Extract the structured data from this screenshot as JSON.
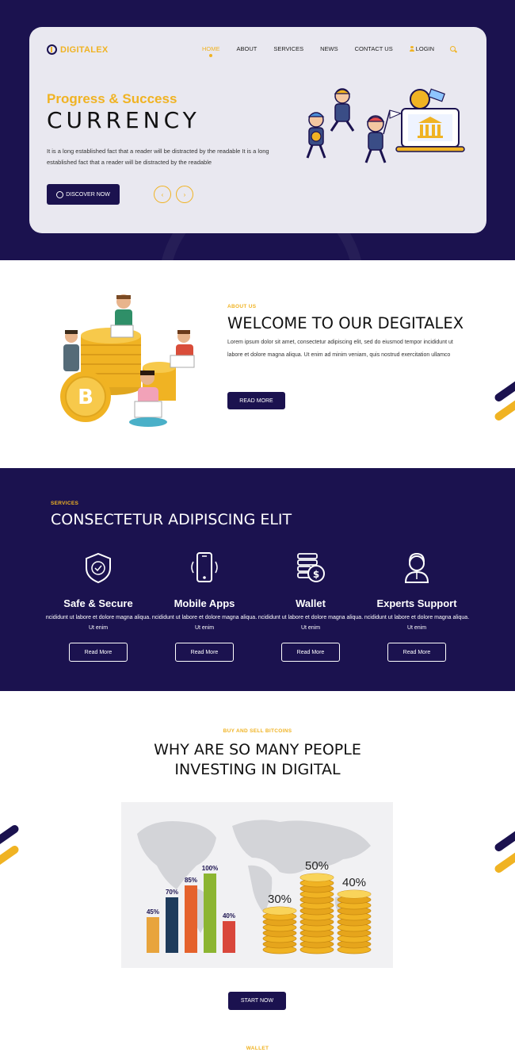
{
  "header": {
    "logo": "DIGITALEX",
    "nav": [
      "HOME",
      "ABOUT",
      "SERVICES",
      "NEWS",
      "CONTACT US"
    ],
    "login": "LOGIN"
  },
  "hero": {
    "subtitle": "Progress & Success",
    "title": "CURRENCY",
    "description": "It is a long established fact that a reader will be distracted by the readable It is a long established fact that a reader will be distracted by the readable",
    "cta": "DISCOVER NOW",
    "prev": "‹",
    "next": "›"
  },
  "about": {
    "label": "ABOUT US",
    "title": "WELCOME TO OUR DEGITALEX",
    "text": "Lorem ipsum dolor sit amet, consectetur adipiscing elit, sed do eiusmod tempor incididunt ut labore et dolore magna aliqua. Ut enim ad minim veniam, quis nostrud exercitation ullamco",
    "button": "READ MORE",
    "coin_symbol": "B"
  },
  "services": {
    "label": "SERVICES",
    "title": "CONSECTETUR ADIPISCING ELIT",
    "items": [
      {
        "name": "Safe & Secure",
        "desc": "ncididunt ut labore et dolore magna aliqua. Ut enim",
        "button": "Read More",
        "icon": "shield-icon"
      },
      {
        "name": "Mobile Apps",
        "desc": "ncididunt ut labore et dolore magna aliqua. Ut enim",
        "button": "Read More",
        "icon": "smartphone-icon"
      },
      {
        "name": "Wallet",
        "desc": "ncididunt ut labore et dolore magna aliqua. Ut enim",
        "button": "Read More",
        "icon": "coins-icon"
      },
      {
        "name": "Experts Support",
        "desc": "ncididunt ut labore et dolore magna aliqua. Ut enim",
        "button": "Read More",
        "icon": "support-agent-icon"
      }
    ]
  },
  "why": {
    "label": "BUY AND SELL BITCOINS",
    "title_line1": "WHY ARE SO MANY PEOPLE",
    "title_line2": "INVESTING IN DIGITAL",
    "button": "START NOW"
  },
  "chart_data": {
    "type": "bar",
    "title": "",
    "categories": [
      "",
      "",
      "",
      "",
      ""
    ],
    "values": [
      45,
      70,
      85,
      100,
      40
    ],
    "value_labels": [
      "45%",
      "70%",
      "85%",
      "100%",
      "40%"
    ],
    "colors": [
      "#e8a43c",
      "#1e3b5c",
      "#e5622c",
      "#8cb531",
      "#d9473b"
    ],
    "ylim": [
      0,
      100
    ],
    "coin_stacks": {
      "values": [
        30,
        50,
        40
      ],
      "labels": [
        "30%",
        "50%",
        "40%"
      ]
    }
  },
  "wallet": {
    "label": "WALLET"
  },
  "colors": {
    "navy": "#1b124f",
    "gold": "#f0b323",
    "card": "#e9e8f0"
  }
}
